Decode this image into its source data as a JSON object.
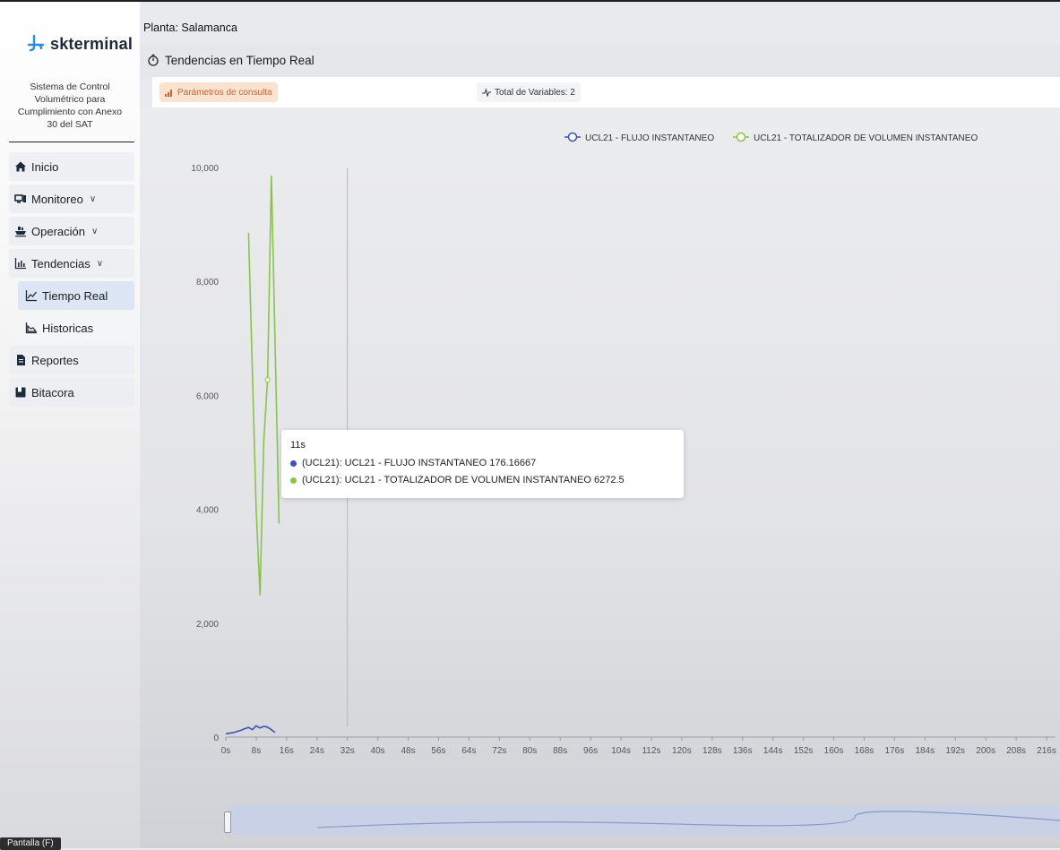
{
  "brand": {
    "name": "skterminal"
  },
  "system_description": [
    "Sistema de Control",
    "Volumétrico para",
    "Cumplimiento con Anexo",
    "30 del SAT"
  ],
  "nav": [
    {
      "label": "Inicio",
      "icon": "home-icon"
    },
    {
      "label": "Monitoreo",
      "icon": "monitor-icon",
      "expand": "∨"
    },
    {
      "label": "Operación",
      "icon": "ship-icon",
      "expand": "∨"
    },
    {
      "label": "Tendencias",
      "icon": "bar-chart-icon",
      "expand": "∨"
    },
    {
      "label": "Tiempo Real",
      "icon": "line-chart-icon",
      "sub": true,
      "active": true
    },
    {
      "label": "Historicas",
      "icon": "area-chart-icon",
      "sub": true
    },
    {
      "label": "Reportes",
      "icon": "file-icon"
    },
    {
      "label": "Bitacora",
      "icon": "book-icon"
    }
  ],
  "tooltip_chip": "Pantalla (F)",
  "header": {
    "planta": "Planta: Salamanca",
    "title": "Tendencias en Tiempo Real"
  },
  "toolbar": {
    "params_label": "Parámetros de consulta",
    "vars_label": "Total de Variables: 2"
  },
  "colors": {
    "series1": "#3f51b5",
    "series2": "#8bc34a",
    "params_bg": "#fbe3cf",
    "params_text": "#c9653a"
  },
  "tooltip": {
    "time": "11s",
    "rows": [
      {
        "text": "(UCL21): UCL21 - FLUJO INSTANTANEO 176.16667"
      },
      {
        "text": "(UCL21): UCL21 - TOTALIZADOR DE VOLUMEN INSTANTANEO 6272.5"
      }
    ]
  },
  "chart_data": {
    "type": "line",
    "ylim": [
      0,
      10000
    ],
    "yticks": [
      "0",
      "2,000",
      "4,000",
      "6,000",
      "8,000",
      "10,000"
    ],
    "xticks": [
      "0s",
      "8s",
      "16s",
      "24s",
      "32s",
      "40s",
      "48s",
      "56s",
      "64s",
      "72s",
      "80s",
      "88s",
      "96s",
      "104s",
      "112s",
      "120s",
      "128s",
      "136s",
      "144s",
      "152s",
      "160s",
      "168s",
      "176s",
      "184s",
      "192s",
      "200s",
      "208s",
      "216s"
    ],
    "x_max_seconds": 216,
    "legend_position": "top-right",
    "cursor_x_seconds": 32,
    "series": [
      {
        "name": "UCL21 - FLUJO INSTANTANEO",
        "points": [
          [
            0,
            60
          ],
          [
            2,
            80
          ],
          [
            4,
            120
          ],
          [
            5,
            150
          ],
          [
            6,
            170
          ],
          [
            7,
            130
          ],
          [
            8,
            200
          ],
          [
            9,
            160
          ],
          [
            10,
            190
          ],
          [
            11,
            176
          ],
          [
            12,
            130
          ],
          [
            13,
            80
          ]
        ]
      },
      {
        "name": "UCL21 - TOTALIZADOR DE VOLUMEN INSTANTANEO",
        "points": [
          [
            6,
            8850
          ],
          [
            8,
            4000
          ],
          [
            9,
            2500
          ],
          [
            10,
            5200
          ],
          [
            11,
            6272.5
          ],
          [
            12,
            9850
          ],
          [
            14,
            3750
          ]
        ]
      }
    ]
  }
}
